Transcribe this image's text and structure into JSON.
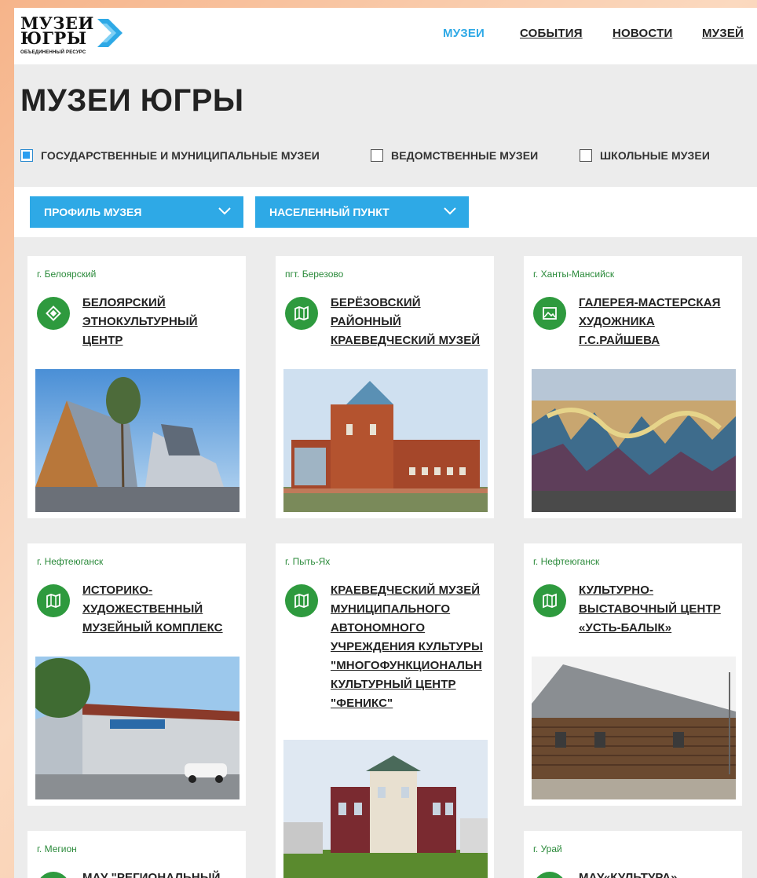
{
  "logo": {
    "line1": "МУЗЕИ",
    "line2": "ЮГРЫ",
    "subtitle": "ОБЪЕДИНЕННЫЙ РЕСУРС"
  },
  "nav": {
    "items": [
      {
        "label": "МУЗЕИ",
        "active": true
      },
      {
        "label": "СОБЫТИЯ",
        "active": false
      },
      {
        "label": "НОВОСТИ",
        "active": false
      },
      {
        "label": "МУЗЕЙ",
        "active": false
      }
    ]
  },
  "page": {
    "title": "МУЗЕИ ЮГРЫ"
  },
  "filters": {
    "checkboxes": [
      {
        "label": "ГОСУДАРСТВЕННЫЕ И МУНИЦИПАЛЬНЫЕ МУЗЕИ",
        "checked": true
      },
      {
        "label": "ВЕДОМСТВЕННЫЕ МУЗЕИ",
        "checked": false
      },
      {
        "label": "ШКОЛЬНЫЕ МУЗЕИ",
        "checked": false
      }
    ],
    "dropdowns": [
      {
        "label": "ПРОФИЛЬ МУЗЕЯ"
      },
      {
        "label": "НАСЕЛЕННЫЙ ПУНКТ"
      }
    ]
  },
  "colors": {
    "accent_blue": "#2ea9e6",
    "icon_green": "#2e9a3e",
    "city_green": "#2a8a3a"
  },
  "cards": [
    {
      "city": "г. Белоярский",
      "title": "БЕЛОЯРСКИЙ\nЭТНОКУЛЬТУРНЫЙ\nЦЕНТР",
      "icon": "diamond-ornament-icon"
    },
    {
      "city": "пгт. Березово",
      "title": "БЕРЁЗОВСКИЙ\nРАЙОННЫЙ\nКРАЕВЕДЧЕСКИЙ МУЗЕЙ",
      "icon": "map-icon"
    },
    {
      "city": "г. Ханты-Мансийск",
      "title": "ГАЛЕРЕЯ-МАСТЕРСКАЯ\nХУДОЖНИКА\nГ.С.РАЙШЕВА",
      "icon": "picture-icon"
    },
    {
      "city": "г. Нефтеюганск",
      "title": "ИСТОРИКО-\nХУДОЖЕСТВЕННЫЙ\nМУЗЕЙНЫЙ КОМПЛЕКС",
      "icon": "map-icon"
    },
    {
      "city": "г. Пыть-Ях",
      "title": "КРАЕВЕДЧЕСКИЙ МУЗЕЙ\nМУНИЦИПАЛЬНОГО\nАВТОНОМНОГО\nУЧРЕЖДЕНИЯ КУЛЬТУРЫ\n\"МНОГОФУНКЦИОНАЛЬН\nКУЛЬТУРНЫЙ ЦЕНТР\n\"ФЕНИКС\"",
      "icon": "map-icon"
    },
    {
      "city": "г. Нефтеюганск",
      "title": "КУЛЬТУРНО-\nВЫСТАВОЧНЫЙ ЦЕНТР\n«УСТЬ-БАЛЫК»",
      "icon": "map-icon"
    },
    {
      "city": "г. Мегион",
      "title": "МАУ \"РЕГИОНАЛЬНЫЙ",
      "icon": "map-icon"
    },
    {
      "city": "г. Урай",
      "title": "МАУ«КУЛЬТУРА»",
      "icon": "map-icon"
    }
  ]
}
